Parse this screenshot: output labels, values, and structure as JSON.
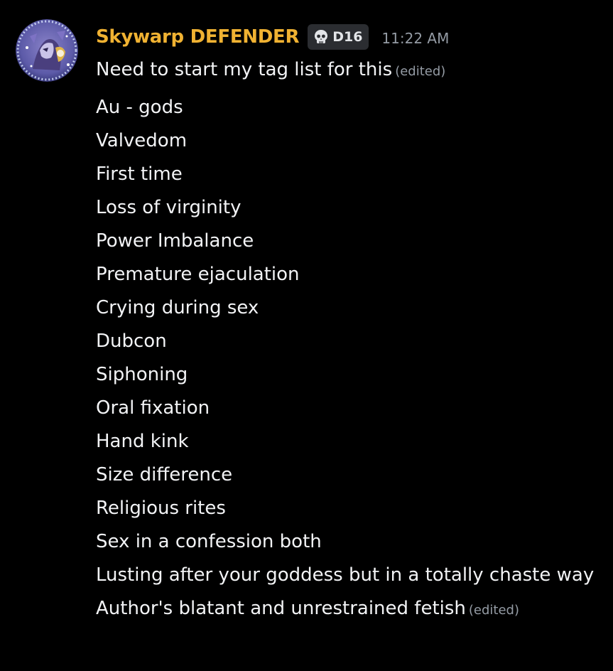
{
  "message": {
    "author": "Skywarp DEFENDER",
    "tag": {
      "icon": "skull-icon",
      "text": "D16"
    },
    "timestamp": "11:22 AM",
    "first_line": "Need to start my tag list for this",
    "first_line_edited": "(edited)",
    "tags": [
      "Au - gods",
      "Valvedom",
      "First time",
      "Loss of virginity",
      "Power Imbalance",
      "Premature ejaculation",
      "Crying during sex",
      "Dubcon",
      "Siphoning",
      "Oral fixation",
      "Hand kink",
      "Size difference",
      "Religious rites",
      "Sex in a confession both",
      "Lusting after your goddess but in a totally chaste way"
    ],
    "last_line": "Author's blatant and unrestrained fetish",
    "last_line_edited": "(edited)"
  },
  "colors": {
    "background": "#000000",
    "username": "#f0b232",
    "text": "#f2f3f5",
    "muted": "#949ba4",
    "tag_bg": "#2b2d31"
  }
}
